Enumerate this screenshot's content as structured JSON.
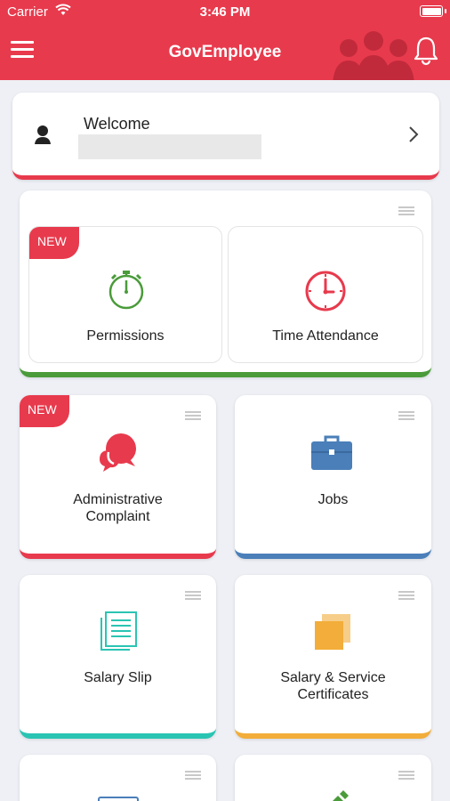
{
  "status": {
    "carrier": "Carrier",
    "time": "3:46 PM"
  },
  "nav": {
    "title": "GovEmployee"
  },
  "welcome": {
    "label": "Welcome"
  },
  "badge": {
    "new": "NEW"
  },
  "tiles": {
    "permissions": "Permissions",
    "time_attendance": "Time Attendance",
    "admin_line1": "Administrative",
    "admin_line2": "Complaint",
    "jobs": "Jobs",
    "salary_slip": "Salary Slip",
    "certs_line1": "Salary & Service",
    "certs_line2": "Certificates"
  },
  "colors": {
    "brand": "#e83a4d",
    "green": "#4a9b3a",
    "blue": "#4a7fb9",
    "teal": "#2ac4b3",
    "amber": "#f2ad3a"
  },
  "icons": [
    "menu-icon",
    "bell-icon",
    "user-icon",
    "chevron-right-icon",
    "stopwatch-icon",
    "clock-icon",
    "chat-bubbles-icon",
    "briefcase-icon",
    "document-list-icon",
    "copy-documents-icon"
  ]
}
